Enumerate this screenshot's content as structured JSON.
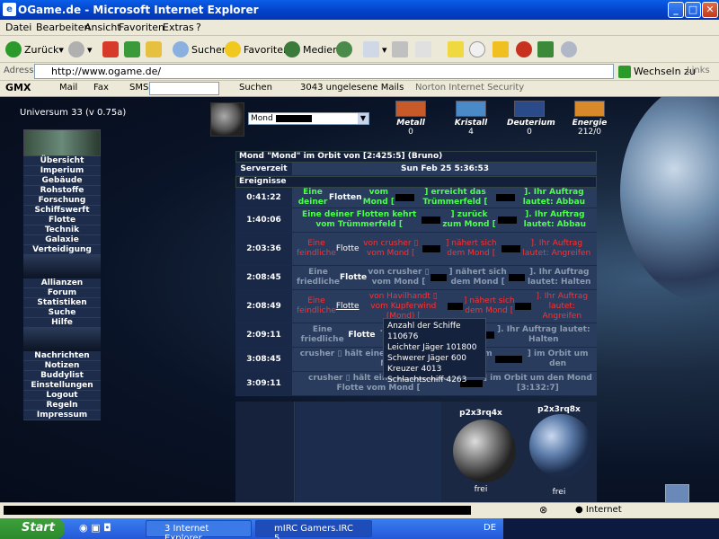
{
  "window": {
    "title": "OGame.de - Microsoft Internet Explorer"
  },
  "menu": [
    "Datei",
    "Bearbeiten",
    "Ansicht",
    "Favoriten",
    "Extras",
    "?"
  ],
  "toolbar": {
    "back": "Zurück",
    "search": "Suchen",
    "favorites": "Favoriten",
    "media": "Medien"
  },
  "address": {
    "label": "Adresse",
    "url": "http://www.ogame.de/",
    "go": "Wechseln zu",
    "links": "Links"
  },
  "gmx": {
    "logo": "GMX",
    "mail": "Mail",
    "fax": "Fax",
    "sms": "SMS",
    "search": "Suchen",
    "unread": "3043 ungelesene Mails",
    "norton": "Norton Internet Security"
  },
  "game": {
    "universe": "Universum 33 (v 0.75a)",
    "planet_select": "Mond",
    "resources": [
      {
        "name": "Metall",
        "value": "0",
        "color": "#c85a2a"
      },
      {
        "name": "Kristall",
        "value": "4",
        "color": "#4a8ac8"
      },
      {
        "name": "Deuterium",
        "value": "0",
        "color": "#2a4a8a"
      },
      {
        "name": "Energie",
        "value": "212/0",
        "color": "#d88a2a"
      }
    ],
    "menu1": [
      "Übersicht",
      "Imperium",
      "Gebäude",
      "Rohstoffe",
      "Forschung",
      "Schiffswerft",
      "Flotte",
      "Technik",
      "Galaxie",
      "Verteidigung"
    ],
    "menu2": [
      "Allianzen",
      "Forum",
      "Statistiken",
      "Suche",
      "Hilfe"
    ],
    "menu3": [
      "Nachrichten",
      "Notizen",
      "Buddylist",
      "Einstellungen",
      "Logout",
      "Regeln",
      "Impressum"
    ],
    "header": "Mond \"Mond\" im Orbit von [2:425:5] (Bruno)",
    "server_label": "Serverzeit",
    "server_time": "Sun Feb 25 5:36:53",
    "events_label": "Ereignisse",
    "events": [
      {
        "time": "0:41:22",
        "text": "Eine deiner Flotten vom Mond [ ] erreicht das Trümmerfeld [ ]. Ihr Auftrag lautet: Abbau"
      },
      {
        "time": "1:40:06",
        "text": "Eine deiner Flotten kehrt vom Trümmerfeld [ ] zurück zum Mond [ ]. Ihr Auftrag lautet: Abbau"
      },
      {
        "time": "2:03:36",
        "text": "Eine feindliche Flotte von crusher vom Mond [ ] nähert sich dem Mond [ ]. Ihr Auftrag lautet: Angreifen"
      },
      {
        "time": "2:08:45",
        "text": "Eine friedliche Flotte von crusher vom Mond [ ] nähert sich dem Mond [ ]. Ihr Auftrag lautet: Halten"
      },
      {
        "time": "2:08:49",
        "text": "Eine feindliche Flotte von Havilhandt vom Kupferwind (Mond) [ ] nähert sich dem Mond [ ]. Ihr Auftrag lautet: Angreifen"
      },
      {
        "time": "2:09:11",
        "text": "Eine friedliche Flotte ... nähert sich dem Mond [ ]. Ihr Auftrag lautet: Halten"
      },
      {
        "time": "3:08:45",
        "text": "crusher hält eine verbündete Flotte vom Mond [ ] im Orbit um den"
      },
      {
        "time": "3:09:11",
        "text": "crusher hält eine verbündete Flotte vom Mond [ ] im Orbit um den Mond [3:132:7]"
      }
    ],
    "tooltip": [
      "Anzahl der Schiffe",
      "110676",
      "Leichter Jäger 101800",
      "Schwerer Jäger 600",
      "Kreuzer 4013",
      "Schlachtschiff 4263"
    ],
    "bottom": [
      {
        "name": "p2x3rq4x",
        "status": "frei"
      },
      {
        "name": "p2x3rq8x",
        "status": "frei"
      }
    ]
  },
  "status": {
    "zone": "Internet"
  },
  "taskbar": {
    "start": "Start",
    "task1": "3 Internet Explorer",
    "task2": "mIRC Gamers.IRC 5....",
    "lang": "DE"
  }
}
